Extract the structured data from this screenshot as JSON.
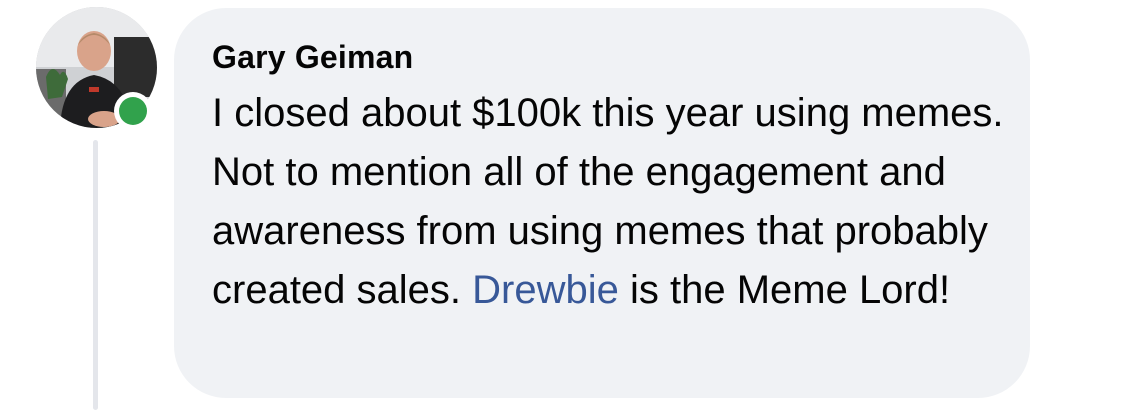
{
  "comment": {
    "author_name": "Gary Geiman",
    "text_before_mention": "I closed about $100k this year using memes. Not to mention all of the engagement and awareness from using memes that probably created sales. ",
    "mention": "Drewbie",
    "text_after_mention": " is the Meme Lord!",
    "online_status_color": "#31a24c",
    "mention_color": "#385898"
  }
}
